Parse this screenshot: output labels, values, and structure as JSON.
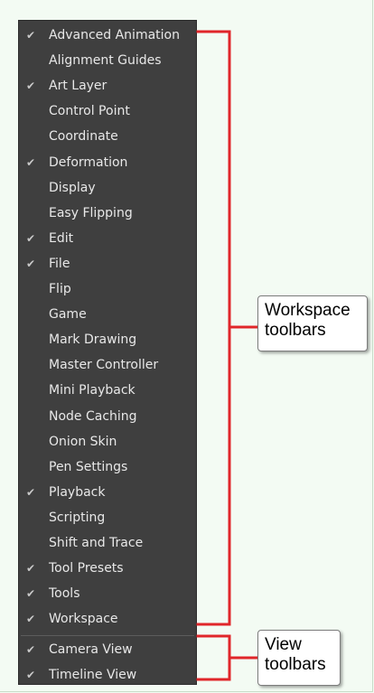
{
  "menu": {
    "items": [
      {
        "label": "Advanced Animation",
        "checked": true
      },
      {
        "label": "Alignment Guides",
        "checked": false
      },
      {
        "label": "Art Layer",
        "checked": true
      },
      {
        "label": "Control Point",
        "checked": false
      },
      {
        "label": "Coordinate",
        "checked": false
      },
      {
        "label": "Deformation",
        "checked": true
      },
      {
        "label": "Display",
        "checked": false
      },
      {
        "label": "Easy Flipping",
        "checked": false
      },
      {
        "label": "Edit",
        "checked": true
      },
      {
        "label": "File",
        "checked": true
      },
      {
        "label": "Flip",
        "checked": false
      },
      {
        "label": "Game",
        "checked": false
      },
      {
        "label": "Mark Drawing",
        "checked": false
      },
      {
        "label": "Master Controller",
        "checked": false
      },
      {
        "label": "Mini Playback",
        "checked": false
      },
      {
        "label": "Node Caching",
        "checked": false
      },
      {
        "label": "Onion Skin",
        "checked": false
      },
      {
        "label": "Pen Settings",
        "checked": false
      },
      {
        "label": "Playback",
        "checked": true
      },
      {
        "label": "Scripting",
        "checked": false
      },
      {
        "label": "Shift and Trace",
        "checked": false
      },
      {
        "label": "Tool Presets",
        "checked": true
      },
      {
        "label": "Tools",
        "checked": true
      },
      {
        "label": "Workspace",
        "checked": true
      }
    ],
    "view_items": [
      {
        "label": "Camera View",
        "checked": true
      },
      {
        "label": "Timeline View",
        "checked": true
      }
    ],
    "check_glyph": "✔"
  },
  "callouts": {
    "workspace": {
      "line1": "Workspace",
      "line2": "toolbars"
    },
    "view": {
      "line1": "View",
      "line2": "toolbars"
    }
  },
  "colors": {
    "bracket": "#e0262a",
    "menu_bg": "#3f3f3f",
    "page_bg": "#f3fbf3"
  }
}
